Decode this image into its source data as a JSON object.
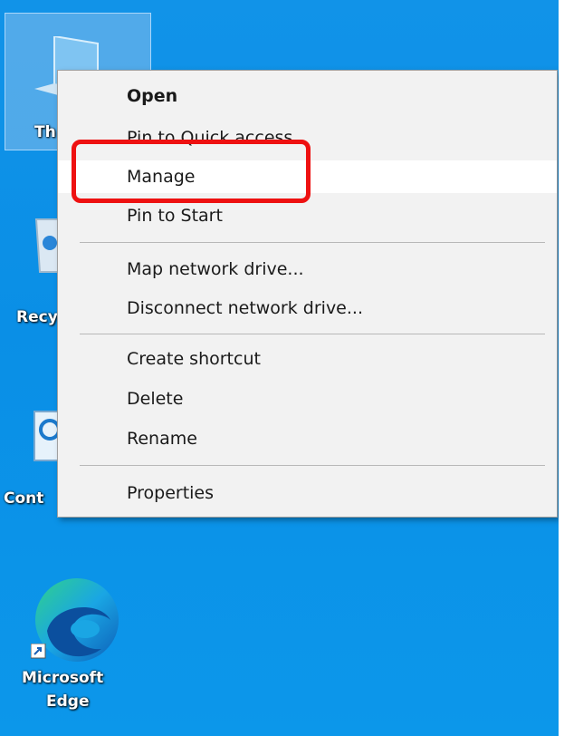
{
  "desktop": {
    "icons": [
      {
        "label": "Th",
        "icon": "this-pc-icon"
      },
      {
        "label": "Recy",
        "icon": "recycle-bin-icon"
      },
      {
        "label": "Cont",
        "icon": "control-panel-icon"
      },
      {
        "label_line1": "Microsoft",
        "label_line2": "Edge",
        "icon": "edge-icon"
      }
    ]
  },
  "context_menu": {
    "items": [
      {
        "label": "Open",
        "bold": true
      },
      {
        "label": "Pin to Quick access"
      },
      {
        "label": "Manage",
        "highlighted": true
      },
      {
        "label": "Pin to Start"
      },
      {
        "label": "Map network drive..."
      },
      {
        "label": "Disconnect network drive..."
      },
      {
        "label": "Create shortcut"
      },
      {
        "label": "Delete"
      },
      {
        "label": "Rename"
      },
      {
        "label": "Properties"
      }
    ]
  },
  "annotation": {
    "color": "#ee1111",
    "target": "Manage"
  }
}
